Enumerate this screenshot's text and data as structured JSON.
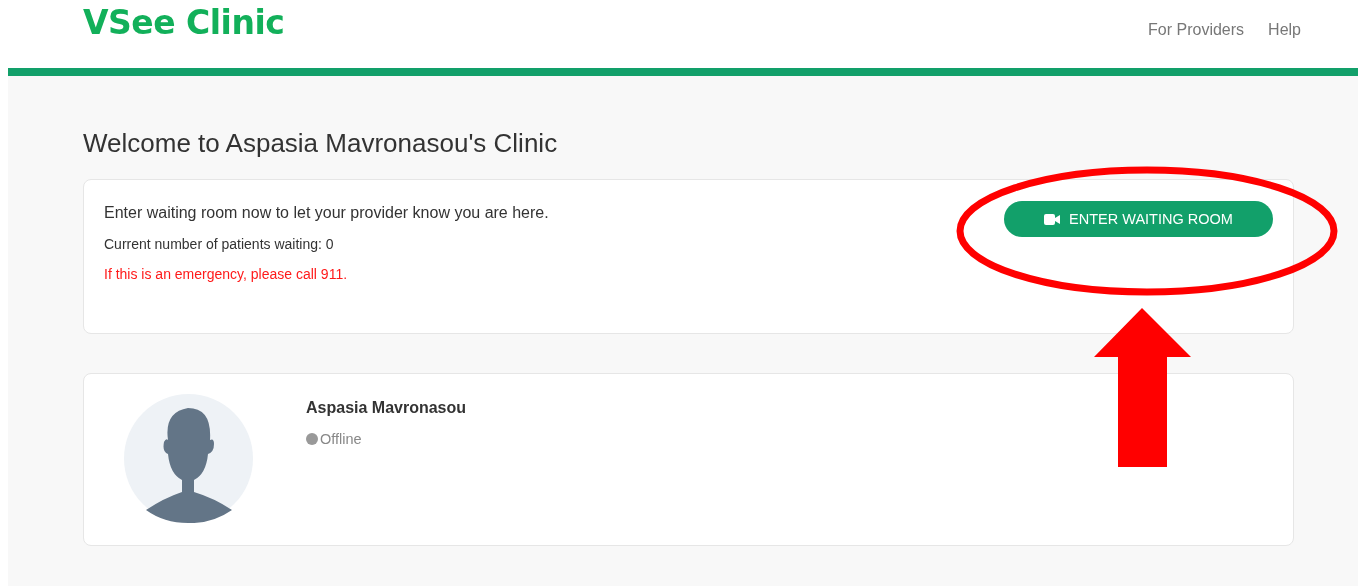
{
  "header": {
    "logo": "VSee Clinic",
    "nav": [
      "For Providers",
      "Help"
    ]
  },
  "title": "Welcome to Aspasia Mavronasou's Clinic",
  "waiting_card": {
    "message": "Enter waiting room now to let your provider know you are here.",
    "patients_waiting": "Current number of patients waiting: 0",
    "emergency": "If this is an emergency, please call 911.",
    "button": "ENTER WAITING ROOM"
  },
  "provider": {
    "name": "Aspasia Mavronasou",
    "status": "Offline",
    "online": false
  },
  "annotations": {
    "ellipse": true,
    "arrow": true
  }
}
